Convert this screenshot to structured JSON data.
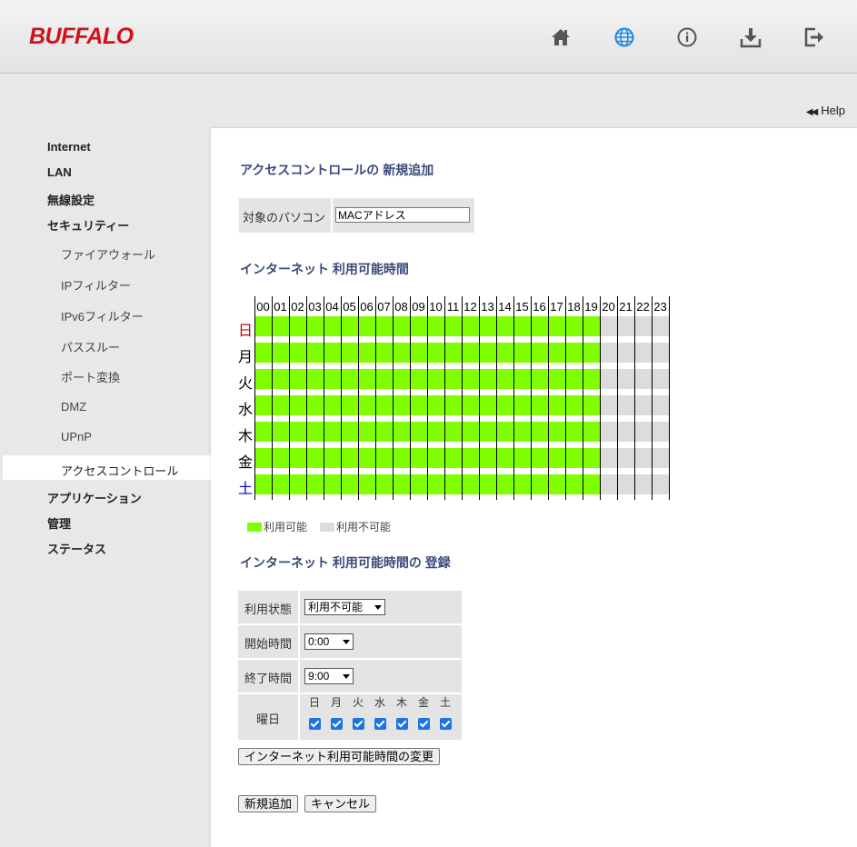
{
  "header": {
    "logo": "BUFFALO",
    "icons": [
      "home-icon",
      "globe-icon",
      "info-icon",
      "download-icon",
      "logout-icon"
    ]
  },
  "help": {
    "label": "Help"
  },
  "sidebar": {
    "items": [
      {
        "label": "Internet"
      },
      {
        "label": "LAN"
      },
      {
        "label": "無線設定"
      },
      {
        "label": "セキュリティー"
      },
      {
        "label": "ファイアウォール"
      },
      {
        "label": "IPフィルター"
      },
      {
        "label": "IPv6フィルター"
      },
      {
        "label": "パススルー"
      },
      {
        "label": "ポート変換"
      },
      {
        "label": "DMZ"
      },
      {
        "label": "UPnP"
      },
      {
        "label": "アクセスコントロール"
      },
      {
        "label": "アプリケーション"
      },
      {
        "label": "管理"
      },
      {
        "label": "ステータス"
      }
    ],
    "active": "アクセスコントロール"
  },
  "main": {
    "title": "アクセスコントロールの 新規追加",
    "target": {
      "label": "対象のパソコン",
      "value": "MACアドレス"
    },
    "schedule_title": "インターネット 利用可能時間",
    "hours": [
      "00",
      "01",
      "02",
      "03",
      "04",
      "05",
      "06",
      "07",
      "08",
      "09",
      "10",
      "11",
      "12",
      "13",
      "14",
      "15",
      "16",
      "17",
      "18",
      "19",
      "20",
      "21",
      "22",
      "23"
    ],
    "days": [
      {
        "label": "日",
        "color": "#cc0000"
      },
      {
        "label": "月",
        "color": "#000000"
      },
      {
        "label": "火",
        "color": "#000000"
      },
      {
        "label": "水",
        "color": "#000000"
      },
      {
        "label": "木",
        "color": "#000000"
      },
      {
        "label": "金",
        "color": "#000000"
      },
      {
        "label": "土",
        "color": "#0000cc"
      }
    ],
    "available_hours": 20,
    "legend": {
      "available": "利用可能",
      "unavailable": "利用不可能"
    },
    "colors": {
      "available": "#7fff00",
      "unavailable": "#dcdcdc"
    },
    "register_title": "インターネット 利用可能時間の 登録",
    "form": {
      "status_label": "利用状態",
      "status_value": "利用不可能",
      "start_label": "開始時間",
      "start_value": "0:00",
      "end_label": "終了時間",
      "end_value": "9:00",
      "weekday_label": "曜日",
      "weekdays": [
        "日",
        "月",
        "火",
        "水",
        "木",
        "金",
        "土"
      ]
    },
    "change_button": "インターネット利用可能時間の変更",
    "add_button": "新規追加",
    "cancel_button": "キャンセル"
  }
}
